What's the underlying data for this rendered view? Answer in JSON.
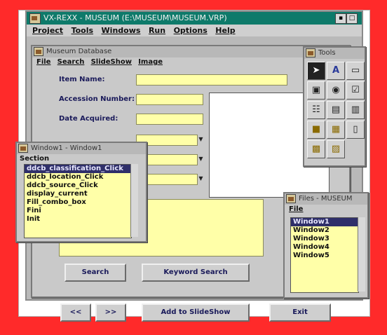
{
  "app": {
    "title": "VX-REXX - MUSEUM (E:\\MUSEUM\\MUSEUM.VRP)",
    "menu": [
      "Project",
      "Tools",
      "Windows",
      "Run",
      "Options",
      "Help"
    ]
  },
  "museum_window": {
    "title": "Museum Database",
    "menu": [
      "File",
      "Search",
      "SlideShow",
      "Image"
    ],
    "fields": {
      "item_name": "Item Name:",
      "accession_number": "Accession Number:",
      "date_acquired": "Date Acquired:"
    },
    "buttons": {
      "search": "Search",
      "keyword_search": "Keyword Search",
      "prev": "<<",
      "next": ">>",
      "add_to_slideshow": "Add to SlideShow",
      "exit": "Exit"
    }
  },
  "section_window": {
    "title": "Window1 - Window1",
    "header": "Section",
    "items": [
      "ddcb_classification_Click",
      "ddcb_location_Click",
      "ddcb_source_Click",
      "display_current",
      "Fill_combo_box",
      "Fini",
      "Init"
    ],
    "selected_index": 0
  },
  "tools_window": {
    "title": "Tools",
    "icons": [
      "pointer-tool",
      "text-tool",
      "frame-tool",
      "picture-tool",
      "radio-tool",
      "checkbox-tool",
      "listbox-tool",
      "combobox-tool",
      "slider-tool",
      "image-tool",
      "group-tool",
      "container-tool",
      "label-tool",
      "entry-tool"
    ]
  },
  "files_window": {
    "title": "Files - MUSEUM",
    "menu": [
      "File"
    ],
    "items": [
      "Window1",
      "Window2",
      "Window3",
      "Window4",
      "Window5"
    ],
    "selected_index": 0
  },
  "colors": {
    "background": "#ff2a2a",
    "titlebar": "#0e7a6a",
    "field": "#ffffa8",
    "selection": "#2f2f6a"
  }
}
